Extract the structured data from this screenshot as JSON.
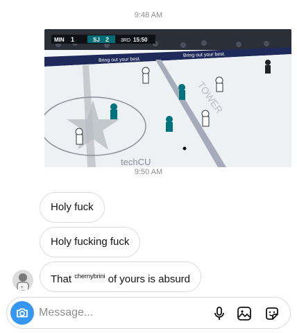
{
  "thread": {
    "timestamp_1": "9:48 AM",
    "timestamp_2": "9:50 AM"
  },
  "shared_post": {
    "scorebug": {
      "team_home": "MIN",
      "score_home": "1",
      "team_away": "SJ",
      "score_away": "2",
      "period": "3RD",
      "clock": "15:50"
    },
    "board_ad": "Bring out your best.",
    "ice_logo_text": "techCU",
    "ice_center_text": "SAP Center"
  },
  "messages": [
    {
      "text": "Holy fuck"
    },
    {
      "text": "Holy fucking fuck"
    },
    {
      "text_before": "That",
      "tag": "chernybrini",
      "text_after": "of yours is absurd"
    }
  ],
  "composer": {
    "placeholder": "Message...",
    "icons": [
      "camera-icon",
      "microphone-icon",
      "gallery-icon",
      "sticker-icon"
    ],
    "accent": "#3797f0"
  }
}
